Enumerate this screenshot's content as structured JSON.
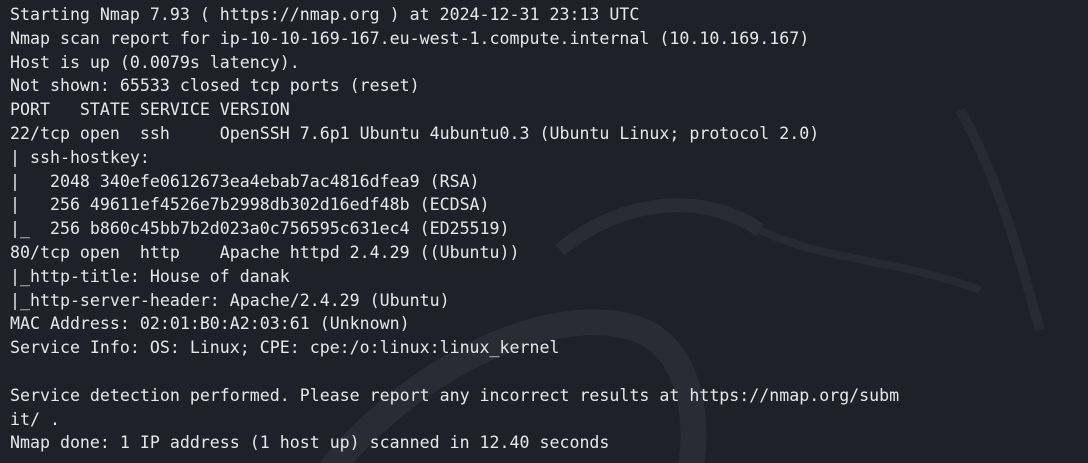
{
  "terminal": {
    "lines": [
      "Starting Nmap 7.93 ( https://nmap.org ) at 2024-12-31 23:13 UTC",
      "Nmap scan report for ip-10-10-169-167.eu-west-1.compute.internal (10.10.169.167)",
      "Host is up (0.0079s latency).",
      "Not shown: 65533 closed tcp ports (reset)",
      "PORT   STATE SERVICE VERSION",
      "22/tcp open  ssh     OpenSSH 7.6p1 Ubuntu 4ubuntu0.3 (Ubuntu Linux; protocol 2.0)",
      "| ssh-hostkey: ",
      "|   2048 340efe0612673ea4ebab7ac4816dfea9 (RSA)",
      "|   256 49611ef4526e7b2998db302d16edf48b (ECDSA)",
      "|_  256 b860c45bb7b2d023a0c756595c631ec4 (ED25519)",
      "80/tcp open  http    Apache httpd 2.4.29 ((Ubuntu))",
      "|_http-title: House of danak",
      "|_http-server-header: Apache/2.4.29 (Ubuntu)",
      "MAC Address: 02:01:B0:A2:03:61 (Unknown)",
      "Service Info: OS: Linux; CPE: cpe:/o:linux:linux_kernel",
      "",
      "Service detection performed. Please report any incorrect results at https://nmap.org/subm",
      "it/ .",
      "Nmap done: 1 IP address (1 host up) scanned in 12.40 seconds"
    ]
  }
}
